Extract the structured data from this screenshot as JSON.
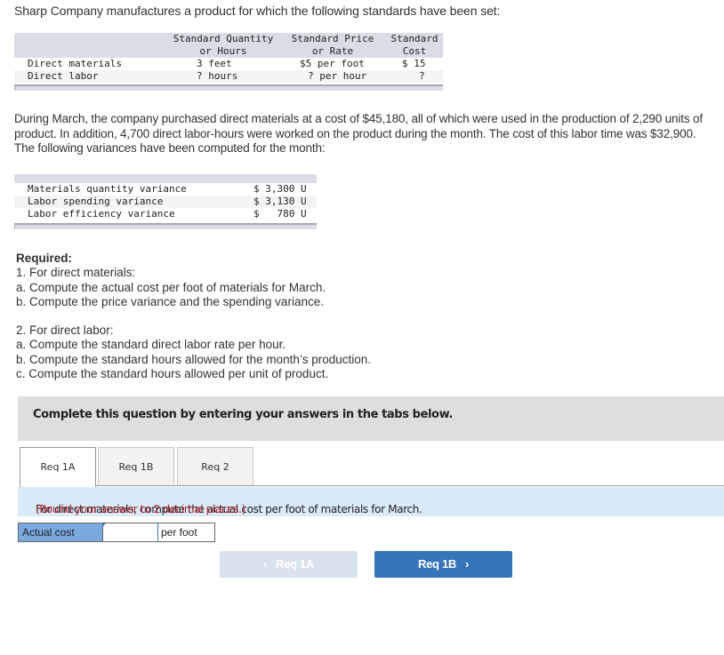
{
  "intro": "Sharp Company manufactures a product for which the following standards have been set:",
  "standards_table": {
    "headers": {
      "qty_line1": "Standard Quantity",
      "qty_line2": "or Hours",
      "price_line1": "Standard Price",
      "price_line2": "or Rate",
      "cost_line1": "Standard",
      "cost_line2": "Cost"
    },
    "rows": [
      {
        "label": "Direct materials",
        "qty": "3 feet",
        "price": "$5 per foot",
        "cost": "$ 15"
      },
      {
        "label": "Direct labor",
        "qty": "? hours",
        "price": "? per hour",
        "cost": "?"
      }
    ]
  },
  "paragraph": "During March, the company purchased direct materials at a cost of $45,180, all of which were used in the production of 2,290 units of product. In addition, 4,700 direct labor-hours were worked on the product during the month. The cost of this labor time was $32,900. The following variances have been computed for the month:",
  "variance_table": {
    "rows": [
      {
        "label": "Materials quantity variance",
        "value": "$ 3,300 U"
      },
      {
        "label": "Labor spending variance",
        "value": "$ 3,130 U"
      },
      {
        "label": "Labor efficiency variance",
        "value": "$   780 U"
      }
    ]
  },
  "required": {
    "title": "Required:",
    "part1": "1. For direct materials:",
    "part1a": "a. Compute the actual cost per foot of materials for March.",
    "part1b": "b. Compute the price variance and the spending variance.",
    "part2": "2. For direct labor:",
    "part2a": "a. Compute the standard direct labor rate per hour.",
    "part2b": "b. Compute the standard hours allowed for the month’s production.",
    "part2c": "c. Compute the standard hours allowed per unit of product."
  },
  "banner": "Complete this question by entering your answers in the tabs below.",
  "tabs": [
    {
      "label": "Req 1A",
      "active": true
    },
    {
      "label": "Req 1B",
      "active": false
    },
    {
      "label": "Req 2",
      "active": false
    }
  ],
  "instruction": {
    "text": "For direct materials, compute the actual cost per foot of materials for March.",
    "note": "(Round your answer to 2 decimal places.)"
  },
  "answer": {
    "label": "Actual cost",
    "value": "",
    "unit": "per foot"
  },
  "nav": {
    "prev_label": "Req 1A",
    "next_label": "Req 1B",
    "prev_icon": "‹",
    "next_icon": "›"
  },
  "colors": {
    "accent": "#3674b8",
    "note_red": "#b0242b",
    "instruction_bg": "#dbeaf7",
    "answer_label_bg": "#7aa9e0"
  }
}
